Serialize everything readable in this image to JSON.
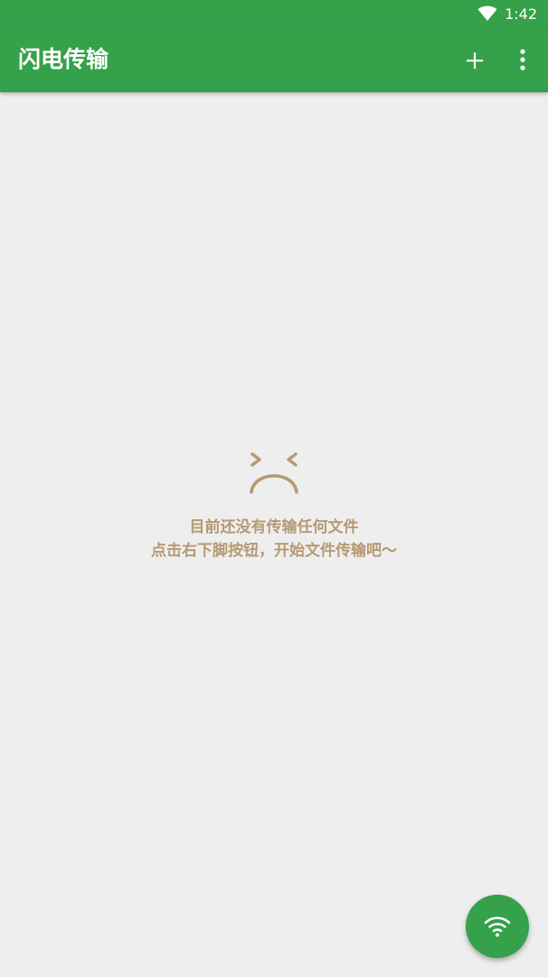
{
  "status_bar": {
    "time": "1:42",
    "icons": [
      "wifi-icon"
    ]
  },
  "app_bar": {
    "title": "闪电传输",
    "actions": [
      "plus-icon",
      "more-vert-icon"
    ]
  },
  "empty_state": {
    "icon": "sad-face-icon",
    "line1": "目前还没有传输任何文件",
    "line2": "点击右下脚按钮，开始文件传输吧～"
  },
  "fab": {
    "icon": "wifi-icon"
  },
  "colors": {
    "primary": "#35a14a",
    "background": "#eeeeee",
    "empty_text": "#b59a72"
  }
}
